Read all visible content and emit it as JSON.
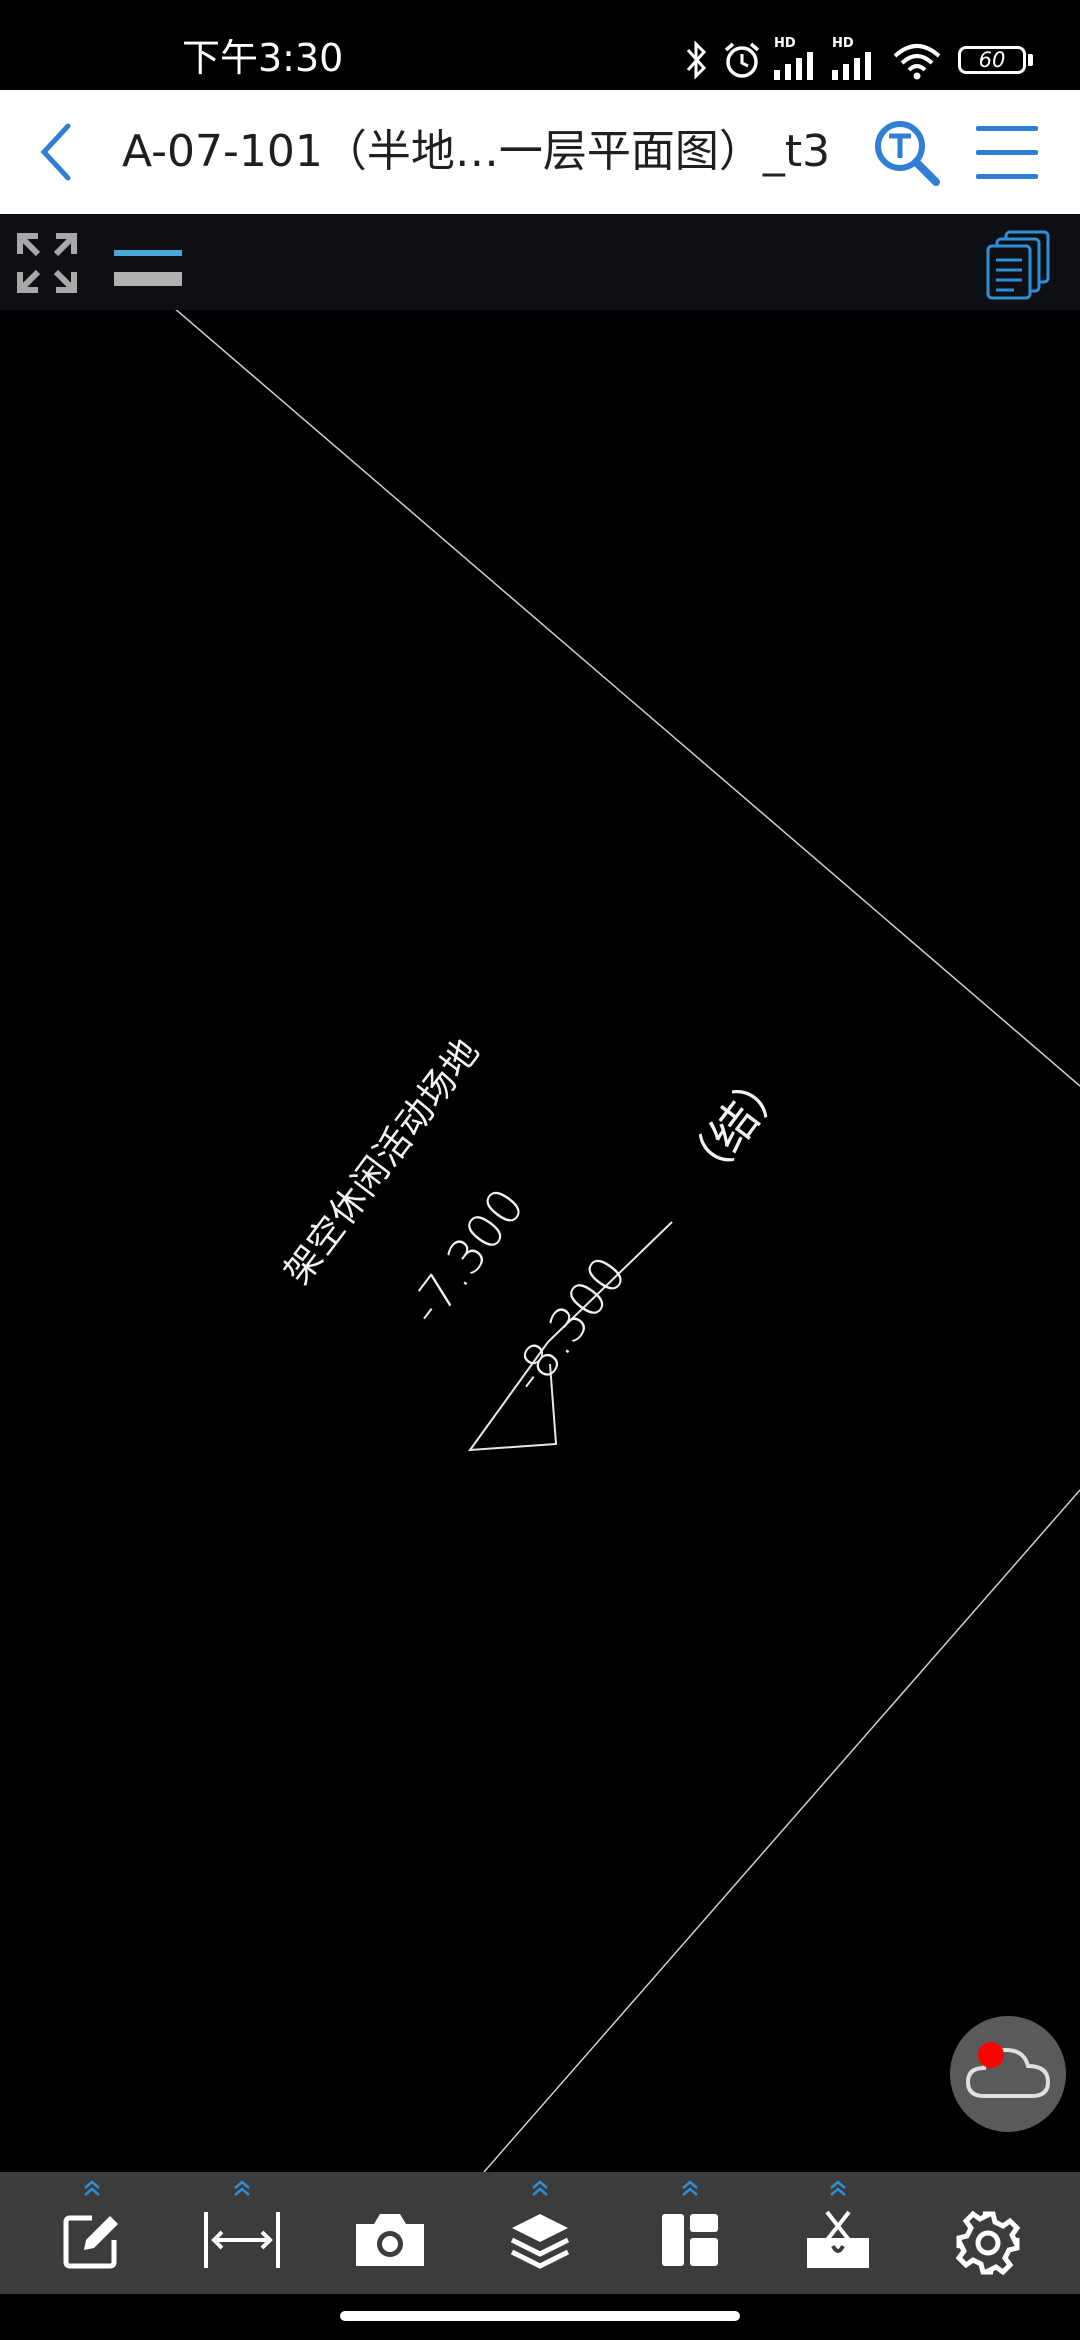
{
  "status_bar": {
    "time": "下午3:30",
    "battery": "60",
    "hd1": "HD",
    "hd2": "HD"
  },
  "header": {
    "title": "A-07-101（半地…一层平面图）_t3",
    "accent_color": "#2f7fd6"
  },
  "drawing": {
    "activity_label": "架空休闲活动场地",
    "elevation_1": "-7.300",
    "elevation_2": "-8.300",
    "paren_label": "（结）"
  },
  "bottom_toolbar": {
    "tools": [
      {
        "icon": "edit-icon"
      },
      {
        "icon": "measure-icon"
      },
      {
        "icon": "camera-icon"
      },
      {
        "icon": "layers-icon"
      },
      {
        "icon": "layout-icon"
      },
      {
        "icon": "toolbox-icon"
      },
      {
        "icon": "settings-icon"
      }
    ]
  }
}
